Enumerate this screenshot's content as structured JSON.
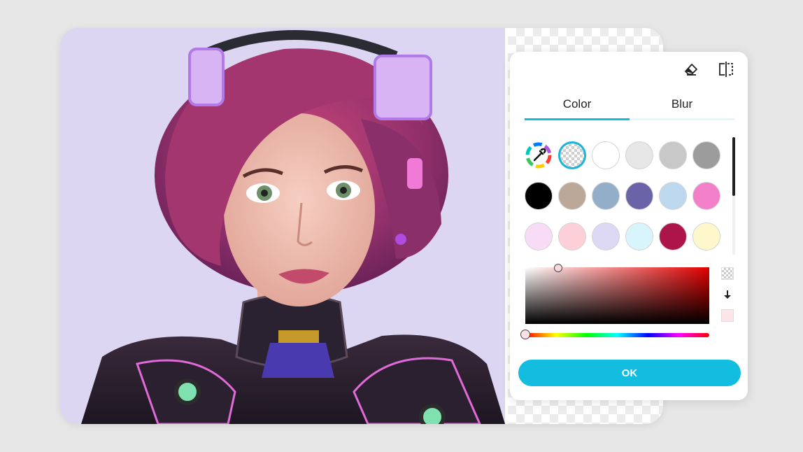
{
  "toolbar": {
    "eraser_icon": "eraser-icon",
    "compare_icon": "split-compare-icon"
  },
  "tabs": [
    {
      "label": "Color",
      "active": true
    },
    {
      "label": "Blur",
      "active": false
    }
  ],
  "colors": {
    "accent": "#12bde0",
    "tab_inactive_line": "#e3f6fb"
  },
  "swatches": [
    {
      "type": "picker",
      "icon": "color-wheel-eyedropper-icon"
    },
    {
      "type": "transparent",
      "selected": true
    },
    {
      "color": "#ffffff"
    },
    {
      "color": "#e6e6e6"
    },
    {
      "color": "#c8c8c8"
    },
    {
      "color": "#9c9c9c"
    },
    {
      "color": "#000000"
    },
    {
      "color": "#bba899"
    },
    {
      "color": "#92aec9"
    },
    {
      "color": "#6b63a8"
    },
    {
      "color": "#bdd7ee"
    },
    {
      "color": "#f280c9"
    },
    {
      "color": "#f8dcf5"
    },
    {
      "color": "#fdd0d8"
    },
    {
      "color": "#dcd7f3"
    },
    {
      "color": "#d8f5fb"
    },
    {
      "color": "#ad1449"
    },
    {
      "color": "#fff7cc"
    }
  ],
  "picker": {
    "from_swatch": "transparent",
    "arrow_icon": "arrow-down-icon",
    "to_swatch": "#fde4e6"
  },
  "ok_label": "OK"
}
